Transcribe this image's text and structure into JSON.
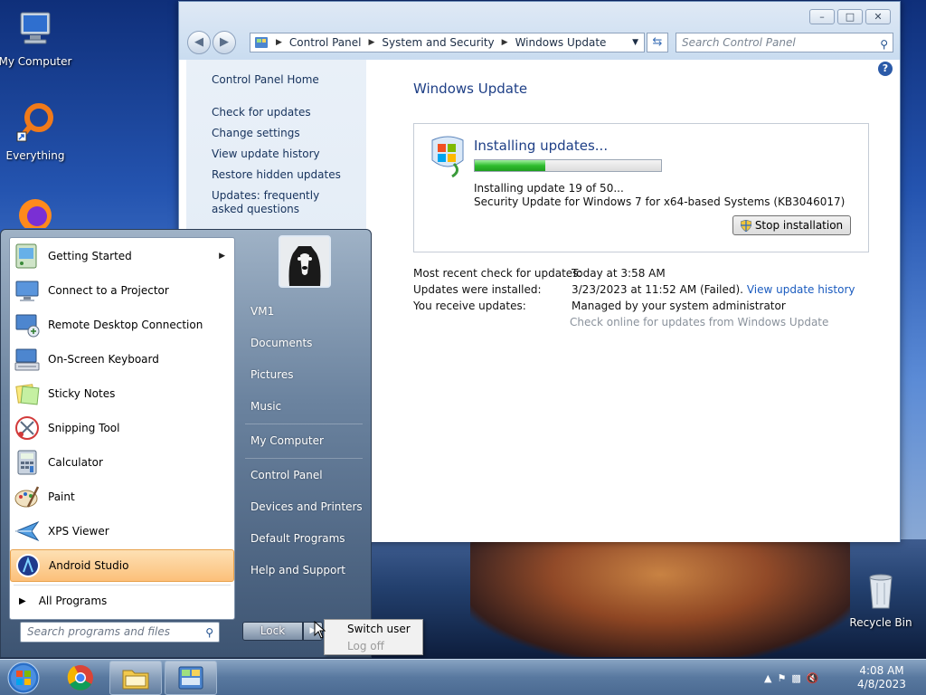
{
  "desktop": {
    "icons": [
      {
        "label": "My Computer"
      },
      {
        "label": "Everything"
      },
      {
        "label": "Recycle Bin"
      }
    ]
  },
  "window": {
    "address": [
      "Control Panel",
      "System and Security",
      "Windows Update"
    ],
    "search_placeholder": "Search Control Panel",
    "sidebar": {
      "home": "Control Panel Home",
      "links": [
        "Check for updates",
        "Change settings",
        "View update history",
        "Restore hidden updates",
        "Updates: frequently asked questions"
      ]
    },
    "title": "Windows Update",
    "status": {
      "heading": "Installing updates...",
      "progress": 0.38,
      "line1": "Installing update 19 of 50...",
      "line2": "Security Update for Windows 7 for x64-based Systems (KB3046017)",
      "stop_button": "Stop installation"
    },
    "info": [
      {
        "label": "Most recent check for updates:",
        "value": "Today at 3:58 AM",
        "link": ""
      },
      {
        "label": "Updates were installed:",
        "value": "3/23/2023 at 11:52 AM (Failed).",
        "link": "View update history"
      },
      {
        "label": "You receive updates:",
        "value": "Managed by your system administrator",
        "link": ""
      }
    ],
    "check_online": "Check online for updates from Windows Update"
  },
  "start_menu": {
    "programs": [
      {
        "label": "Getting Started",
        "icon": "getting-started-icon",
        "submenu": true
      },
      {
        "label": "Connect to a Projector",
        "icon": "projector-icon",
        "submenu": false
      },
      {
        "label": "Remote Desktop Connection",
        "icon": "remote-desktop-icon",
        "submenu": false
      },
      {
        "label": "On-Screen Keyboard",
        "icon": "keyboard-icon",
        "submenu": false
      },
      {
        "label": "Sticky Notes",
        "icon": "sticky-notes-icon",
        "submenu": false
      },
      {
        "label": "Snipping Tool",
        "icon": "snipping-tool-icon",
        "submenu": false
      },
      {
        "label": "Calculator",
        "icon": "calculator-icon",
        "submenu": false
      },
      {
        "label": "Paint",
        "icon": "paint-icon",
        "submenu": false
      },
      {
        "label": "XPS Viewer",
        "icon": "xps-viewer-icon",
        "submenu": false
      },
      {
        "label": "Android Studio",
        "icon": "android-studio-icon",
        "submenu": false
      }
    ],
    "all_programs": "All Programs",
    "search_placeholder": "Search programs and files",
    "right_items": [
      "VM1",
      "Documents",
      "Pictures",
      "Music",
      "My Computer",
      "Control Panel",
      "Devices and Printers",
      "Default Programs",
      "Help and Support"
    ],
    "lock": "Lock",
    "power_menu": {
      "switch_user": "Switch user",
      "log_off": "Log off"
    }
  },
  "taskbar": {
    "clock_time": "4:08 AM",
    "clock_date": "4/8/2023"
  }
}
